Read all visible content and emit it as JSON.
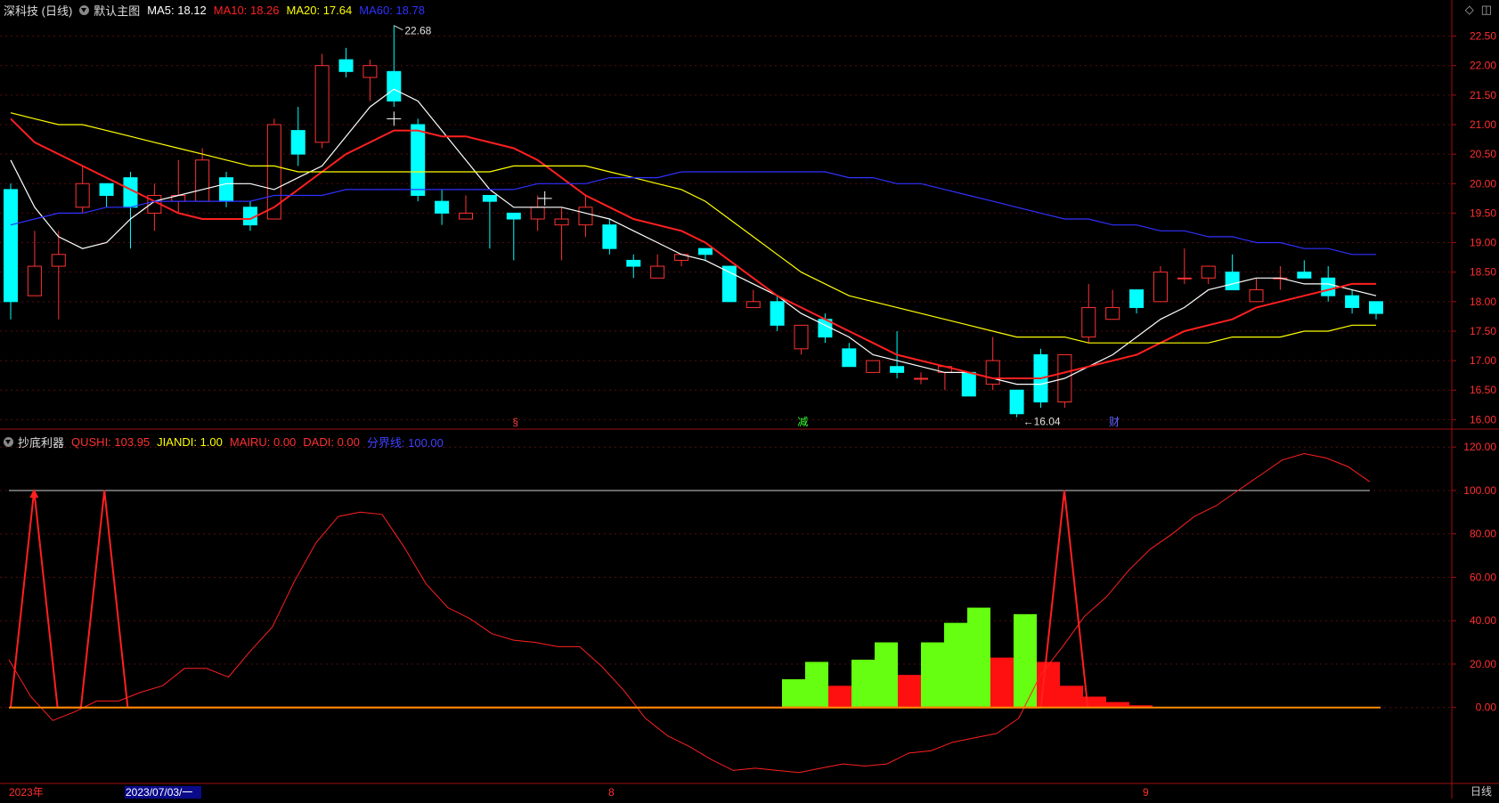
{
  "main_header": {
    "symbol": "深科技 (日线)",
    "template": "默认主图",
    "ma": [
      {
        "label": "MA5: 18.12",
        "color": "#ffffff"
      },
      {
        "label": "MA10: 18.26",
        "color": "#ff2020"
      },
      {
        "label": "MA20: 17.64",
        "color": "#ffff00"
      },
      {
        "label": "MA60: 18.78",
        "color": "#3030ff"
      }
    ]
  },
  "indicator_header": {
    "name": "抄底利器",
    "items": [
      {
        "label": "QUSHI: 103.95",
        "color": "#ff3030"
      },
      {
        "label": "JIANDI: 1.00",
        "color": "#ffff00"
      },
      {
        "label": "MAIRU: 0.00",
        "color": "#ff3030"
      },
      {
        "label": "DADI: 0.00",
        "color": "#ff3030"
      },
      {
        "label": "分界线: 100.00",
        "color": "#4040ff"
      }
    ]
  },
  "top_icons": [
    "diamond-icon",
    "restore-window-icon"
  ],
  "price_axis": {
    "ticks": [
      "22.50",
      "22.00",
      "21.50",
      "21.00",
      "20.50",
      "20.00",
      "19.50",
      "19.00",
      "18.50",
      "18.00",
      "17.50",
      "17.00",
      "16.50",
      "16.00"
    ]
  },
  "ind_axis": {
    "ticks": [
      "120.00",
      "100.00",
      "80.00",
      "60.00",
      "40.00",
      "20.00",
      "0.00"
    ]
  },
  "annotations": {
    "high": "22.68",
    "low": "←16.04"
  },
  "event_marks": [
    {
      "text": "§",
      "color": "#ff4040"
    },
    {
      "text": "减",
      "color": "#30ff30"
    },
    {
      "text": "财",
      "color": "#6060ff"
    }
  ],
  "date_axis": {
    "labels": [
      "2023年",
      "2023/07/03/一",
      "8",
      "9"
    ]
  },
  "bottom_tab": "日线",
  "chart_data": [
    {
      "type": "candlestick",
      "title": "",
      "ylim": [
        15.9,
        22.75
      ],
      "candles": [
        [
          19.9,
          18.0,
          20.0,
          17.7
        ],
        [
          18.1,
          18.6,
          19.2,
          18.1
        ],
        [
          18.6,
          18.8,
          19.2,
          17.7
        ],
        [
          19.6,
          20.0,
          20.3,
          19.5
        ],
        [
          20.0,
          19.8,
          20.0,
          19.6
        ],
        [
          20.1,
          19.6,
          20.2,
          18.9
        ],
        [
          19.5,
          19.8,
          20.0,
          19.2
        ],
        [
          19.7,
          19.8,
          20.4,
          19.5
        ],
        [
          19.7,
          20.4,
          20.6,
          19.7
        ],
        [
          20.1,
          19.7,
          20.2,
          19.6
        ],
        [
          19.6,
          19.3,
          19.7,
          19.2
        ],
        [
          19.4,
          21.0,
          21.1,
          19.4
        ],
        [
          20.9,
          20.5,
          21.3,
          20.3
        ],
        [
          20.7,
          22.0,
          22.2,
          20.6
        ],
        [
          22.1,
          21.9,
          22.3,
          21.8
        ],
        [
          21.8,
          22.0,
          22.1,
          21.4
        ],
        [
          21.9,
          21.4,
          22.68,
          21.3
        ],
        [
          21.0,
          19.8,
          21.1,
          19.7
        ],
        [
          19.7,
          19.5,
          19.9,
          19.3
        ],
        [
          19.4,
          19.5,
          19.8,
          19.4
        ],
        [
          19.8,
          19.7,
          19.8,
          18.9
        ],
        [
          19.5,
          19.4,
          19.5,
          18.7
        ],
        [
          19.4,
          19.6,
          19.8,
          19.2
        ],
        [
          19.3,
          19.4,
          19.6,
          18.7
        ],
        [
          19.3,
          19.6,
          19.8,
          19.1
        ],
        [
          19.3,
          18.9,
          19.4,
          18.8
        ],
        [
          18.7,
          18.6,
          18.8,
          18.4
        ],
        [
          18.4,
          18.6,
          18.8,
          18.4
        ],
        [
          18.7,
          18.8,
          18.8,
          18.6
        ],
        [
          18.9,
          18.8,
          18.9,
          18.7
        ],
        [
          18.6,
          18.0,
          18.6,
          18.0
        ],
        [
          17.9,
          18.0,
          18.2,
          17.9
        ],
        [
          18.0,
          17.6,
          18.1,
          17.5
        ],
        [
          17.2,
          17.6,
          17.6,
          17.1
        ],
        [
          17.7,
          17.4,
          17.8,
          17.3
        ],
        [
          17.2,
          16.9,
          17.3,
          16.9
        ],
        [
          16.8,
          17.0,
          17.0,
          16.8
        ],
        [
          16.9,
          16.8,
          17.5,
          16.7
        ],
        [
          16.7,
          16.7,
          16.8,
          16.6
        ],
        [
          16.8,
          16.9,
          16.9,
          16.5
        ],
        [
          16.8,
          16.4,
          16.8,
          16.4
        ],
        [
          16.6,
          17.0,
          17.4,
          16.5
        ],
        [
          16.5,
          16.1,
          16.5,
          16.04
        ],
        [
          17.1,
          16.3,
          17.2,
          16.2
        ],
        [
          16.3,
          17.1,
          17.1,
          16.2
        ],
        [
          17.4,
          17.9,
          18.3,
          17.3
        ],
        [
          17.7,
          17.9,
          18.2,
          17.7
        ],
        [
          18.2,
          17.9,
          18.2,
          17.8
        ],
        [
          18.0,
          18.5,
          18.6,
          18.0
        ],
        [
          18.4,
          18.4,
          18.9,
          18.3
        ],
        [
          18.4,
          18.6,
          18.6,
          18.3
        ],
        [
          18.5,
          18.2,
          18.8,
          18.2
        ],
        [
          18.0,
          18.2,
          18.4,
          18.0
        ],
        [
          18.4,
          18.4,
          18.6,
          18.2
        ],
        [
          18.5,
          18.4,
          18.7,
          18.4
        ],
        [
          18.4,
          18.1,
          18.6,
          18.0
        ],
        [
          18.1,
          17.9,
          18.2,
          17.8
        ],
        [
          18.0,
          17.8,
          18.0,
          17.7
        ]
      ],
      "series": [
        {
          "name": "MA5",
          "color": "#ffffff",
          "values": [
            20.4,
            19.6,
            19.1,
            18.9,
            19.0,
            19.4,
            19.7,
            19.8,
            19.9,
            20.0,
            20.0,
            19.9,
            20.1,
            20.3,
            20.8,
            21.3,
            21.6,
            21.4,
            20.9,
            20.4,
            19.9,
            19.6,
            19.6,
            19.6,
            19.5,
            19.4,
            19.2,
            19.0,
            18.8,
            18.7,
            18.5,
            18.3,
            18.1,
            17.8,
            17.6,
            17.4,
            17.1,
            17.0,
            16.9,
            16.8,
            16.8,
            16.7,
            16.6,
            16.6,
            16.7,
            16.9,
            17.1,
            17.4,
            17.7,
            17.9,
            18.2,
            18.3,
            18.4,
            18.4,
            18.3,
            18.3,
            18.2,
            18.1
          ]
        },
        {
          "name": "MA10",
          "color": "#ff2020",
          "values": [
            21.1,
            20.7,
            20.5,
            20.3,
            20.1,
            19.9,
            19.7,
            19.5,
            19.4,
            19.4,
            19.4,
            19.6,
            19.9,
            20.2,
            20.5,
            20.7,
            20.9,
            20.9,
            20.8,
            20.8,
            20.7,
            20.6,
            20.4,
            20.1,
            19.8,
            19.6,
            19.4,
            19.3,
            19.2,
            19.0,
            18.7,
            18.4,
            18.1,
            17.9,
            17.7,
            17.5,
            17.3,
            17.1,
            17.0,
            16.9,
            16.8,
            16.7,
            16.7,
            16.7,
            16.8,
            16.9,
            17.0,
            17.1,
            17.3,
            17.5,
            17.6,
            17.7,
            17.9,
            18.0,
            18.1,
            18.2,
            18.3,
            18.3
          ]
        },
        {
          "name": "MA20",
          "color": "#ffff00",
          "values": [
            21.2,
            21.1,
            21.0,
            21.0,
            20.9,
            20.8,
            20.7,
            20.6,
            20.5,
            20.4,
            20.3,
            20.3,
            20.2,
            20.2,
            20.2,
            20.2,
            20.2,
            20.2,
            20.2,
            20.2,
            20.2,
            20.3,
            20.3,
            20.3,
            20.3,
            20.2,
            20.1,
            20.0,
            19.9,
            19.7,
            19.4,
            19.1,
            18.8,
            18.5,
            18.3,
            18.1,
            18.0,
            17.9,
            17.8,
            17.7,
            17.6,
            17.5,
            17.4,
            17.4,
            17.4,
            17.3,
            17.3,
            17.3,
            17.3,
            17.3,
            17.3,
            17.4,
            17.4,
            17.4,
            17.5,
            17.5,
            17.6,
            17.6
          ]
        },
        {
          "name": "MA60",
          "color": "#3030ff",
          "values": [
            19.3,
            19.4,
            19.5,
            19.5,
            19.6,
            19.6,
            19.7,
            19.7,
            19.7,
            19.7,
            19.7,
            19.8,
            19.8,
            19.8,
            19.9,
            19.9,
            19.9,
            19.9,
            19.9,
            19.9,
            19.9,
            19.9,
            20.0,
            20.0,
            20.0,
            20.1,
            20.1,
            20.1,
            20.2,
            20.2,
            20.2,
            20.2,
            20.2,
            20.2,
            20.2,
            20.1,
            20.1,
            20.0,
            20.0,
            19.9,
            19.8,
            19.7,
            19.6,
            19.5,
            19.4,
            19.4,
            19.3,
            19.3,
            19.2,
            19.2,
            19.1,
            19.1,
            19.0,
            19.0,
            18.9,
            18.9,
            18.8,
            18.8
          ]
        }
      ]
    },
    {
      "type": "line",
      "title": "",
      "ylim": [
        -35,
        125
      ],
      "divider": 100,
      "series": [
        {
          "name": "QUSHI",
          "color": "#ff2020",
          "values": [
            22,
            5,
            -6,
            -2,
            3,
            3,
            7,
            10,
            18,
            18,
            14,
            26,
            37,
            58,
            76,
            88,
            90,
            89,
            74,
            57,
            46,
            41,
            34,
            31,
            30,
            28,
            28,
            19,
            8,
            -5,
            -13,
            -18,
            -24,
            -29,
            -28,
            -29,
            -30,
            -28,
            -26,
            -27,
            -26,
            -21,
            -20,
            -16,
            -14,
            -12,
            -5,
            15,
            28,
            42,
            51,
            63,
            73,
            80,
            88,
            93,
            100,
            107,
            114,
            117,
            115,
            111,
            104
          ]
        },
        {
          "name": "MAIRU",
          "color": "#ff2020",
          "values": [
            0,
            100,
            0,
            0,
            100,
            0,
            0,
            0,
            0,
            0,
            0,
            0,
            0,
            0,
            0,
            0,
            0,
            0,
            0,
            0,
            0,
            0,
            0,
            0,
            0,
            0,
            0,
            0,
            0,
            0,
            0,
            0,
            0,
            0,
            0,
            0,
            0,
            0,
            0,
            0,
            0,
            0,
            0,
            0,
            0,
            100,
            0,
            0,
            0,
            0,
            0,
            0,
            0,
            0,
            0,
            0,
            0,
            0,
            0,
            0
          ]
        },
        {
          "name": "JIANDI",
          "color": "#ffff00",
          "values": [
            0
          ]
        }
      ],
      "bars": [
        {
          "index": 34,
          "value": 13,
          "color": "#66ff11"
        },
        {
          "index": 35,
          "value": 21,
          "color": "#66ff11"
        },
        {
          "index": 36,
          "value": 10,
          "color": "#ff1010"
        },
        {
          "index": 37,
          "value": 22,
          "color": "#66ff11"
        },
        {
          "index": 38,
          "value": 30,
          "color": "#66ff11"
        },
        {
          "index": 39,
          "value": 15,
          "color": "#ff1010"
        },
        {
          "index": 40,
          "value": 30,
          "color": "#66ff11"
        },
        {
          "index": 41,
          "value": 39,
          "color": "#66ff11"
        },
        {
          "index": 42,
          "value": 46,
          "color": "#66ff11"
        },
        {
          "index": 43,
          "value": 23,
          "color": "#ff1010"
        },
        {
          "index": 44,
          "value": 43,
          "color": "#66ff11"
        },
        {
          "index": 45,
          "value": 21,
          "color": "#ff1010"
        },
        {
          "index": 46,
          "value": 10,
          "color": "#ff1010"
        },
        {
          "index": 47,
          "value": 5,
          "color": "#ff1010"
        },
        {
          "index": 48,
          "value": 2.5,
          "color": "#ff1010"
        },
        {
          "index": 49,
          "value": 1,
          "color": "#ff1010"
        }
      ]
    }
  ]
}
